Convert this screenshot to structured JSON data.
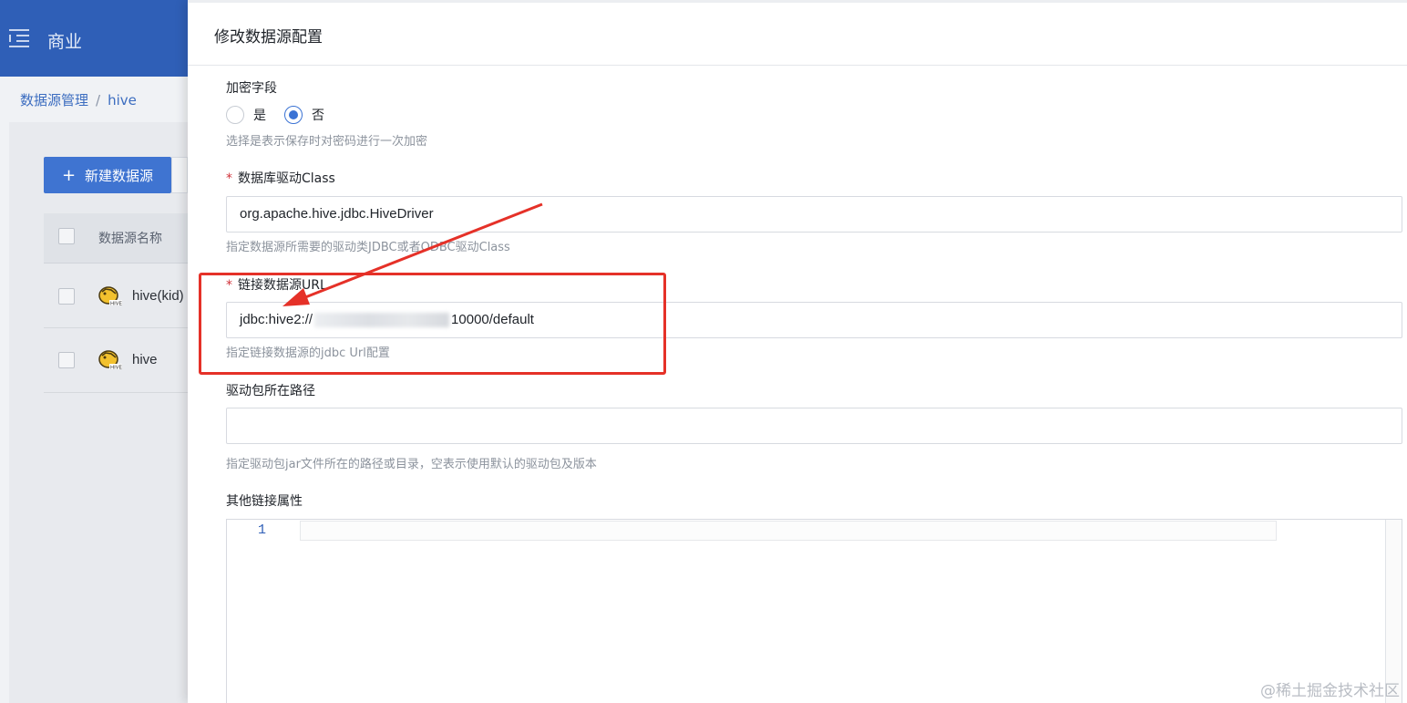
{
  "background_app": {
    "app_name": "商业",
    "breadcrumb": {
      "root": "数据源管理",
      "separator": "/",
      "current": "hive"
    },
    "new_button_label": "新建数据源",
    "table": {
      "column_name": "数据源名称",
      "rows": [
        {
          "name": "hive(kid)"
        },
        {
          "name": "hive"
        }
      ]
    }
  },
  "drawer": {
    "title": "修改数据源配置",
    "encrypt_field": {
      "label": "加密字段",
      "options": [
        {
          "label": "是",
          "checked": false
        },
        {
          "label": "否",
          "checked": true
        }
      ],
      "hint": "选择是表示保存时对密码进行一次加密"
    },
    "driver_class": {
      "required_mark": "*",
      "label": "数据库驱动Class",
      "value": "org.apache.hive.jdbc.HiveDriver",
      "hint": "指定数据源所需要的驱动类JDBC或者ODBC驱动Class"
    },
    "url": {
      "required_mark": "*",
      "label": "链接数据源URL",
      "value_prefix": "jdbc:hive2://",
      "value_suffix": "10000/default",
      "hint": "指定链接数据源的jdbc Url配置"
    },
    "driver_path": {
      "label": "驱动包所在路径",
      "value": "",
      "hint": "指定驱动包jar文件所在的路径或目录，空表示使用默认的驱动包及版本"
    },
    "other_props": {
      "label": "其他链接属性",
      "line_number": "1"
    }
  },
  "watermark": "@稀土掘金技术社区",
  "colors": {
    "accent": "#3b73d4",
    "header_blue": "#2f5fb7",
    "annotation_red": "#e53128",
    "required_red": "#d0323a"
  }
}
